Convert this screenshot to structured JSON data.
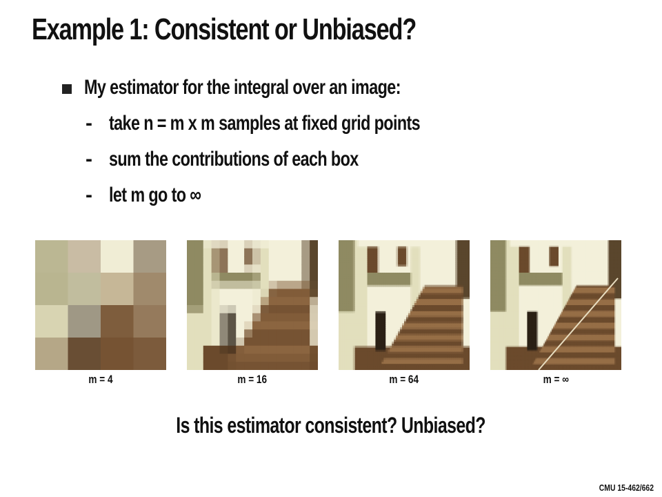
{
  "title": "Example 1: Consistent or Unbiased?",
  "bullet": "My estimator for the integral over an image:",
  "sub_bullets": [
    "take n = m x m samples at fixed grid points",
    "sum the contributions of each box",
    "let m go to ∞"
  ],
  "images": [
    {
      "caption": "m = 4",
      "grid": 4
    },
    {
      "caption": "m = 16",
      "grid": 16
    },
    {
      "caption": "m = 64",
      "grid": 64
    },
    {
      "caption": "m = ∞",
      "grid": 0
    }
  ],
  "question": "Is this estimator consistent?  Unbiased?",
  "footer": "CMU 15-462/662",
  "colors": {
    "olive": "#8f8a62",
    "light": "#e2dfbd",
    "pale": "#f3f0da",
    "brown": "#6b4a2c",
    "dark": "#2a2015"
  }
}
